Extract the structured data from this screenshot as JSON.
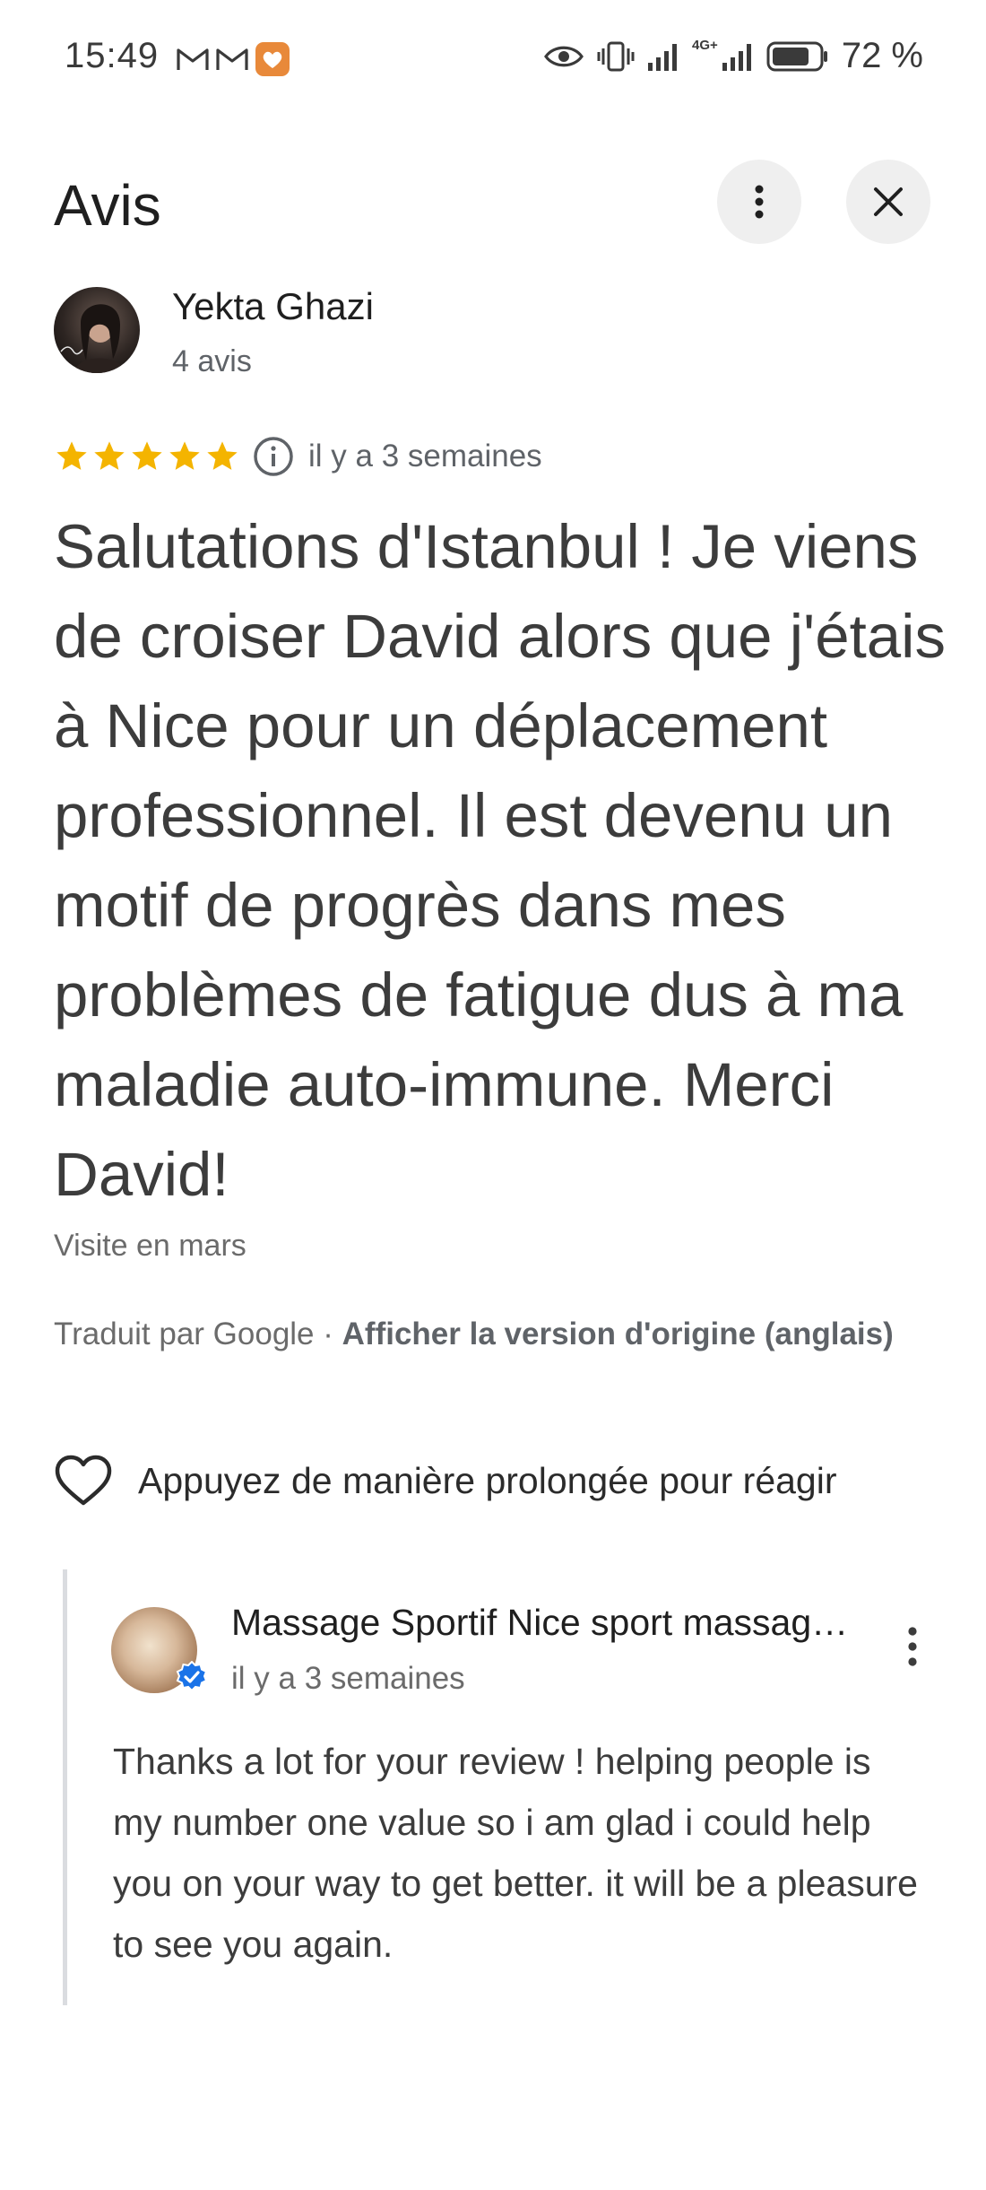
{
  "status_bar": {
    "time": "15:49",
    "battery": "72 %",
    "network": "4G+"
  },
  "header": {
    "title": "Avis"
  },
  "reviewer": {
    "name": "Yekta Ghazi",
    "review_count": "4 avis"
  },
  "review": {
    "rating": 5,
    "max_rating": 5,
    "time_ago": "il y a 3 semaines",
    "text": "Salutations d'Istanbul ! Je viens de croiser David alors que j'étais à Nice pour un déplacement professionnel. Il est devenu un motif de progrès dans mes problèmes de fatigue dus à ma maladie auto-immune. Merci David!",
    "visit": "Visite en mars",
    "translated_by": "Traduit par Google · ",
    "show_original": "Afficher la version d'origine (anglais)",
    "react_hint": "Appuyez de manière prolongée pour réagir"
  },
  "owner_reply": {
    "name": "Massage Sportif Nice sport massage David Kessar",
    "time_ago": "il y a 3 semaines",
    "text": "Thanks a lot for your review ! helping people is my number one value so i am glad i could help you on your way to get better. it will be a pleasure to see you again."
  },
  "colors": {
    "star": "#f4b400",
    "verified": "#1a73e8",
    "muted_text": "#5f6368"
  }
}
